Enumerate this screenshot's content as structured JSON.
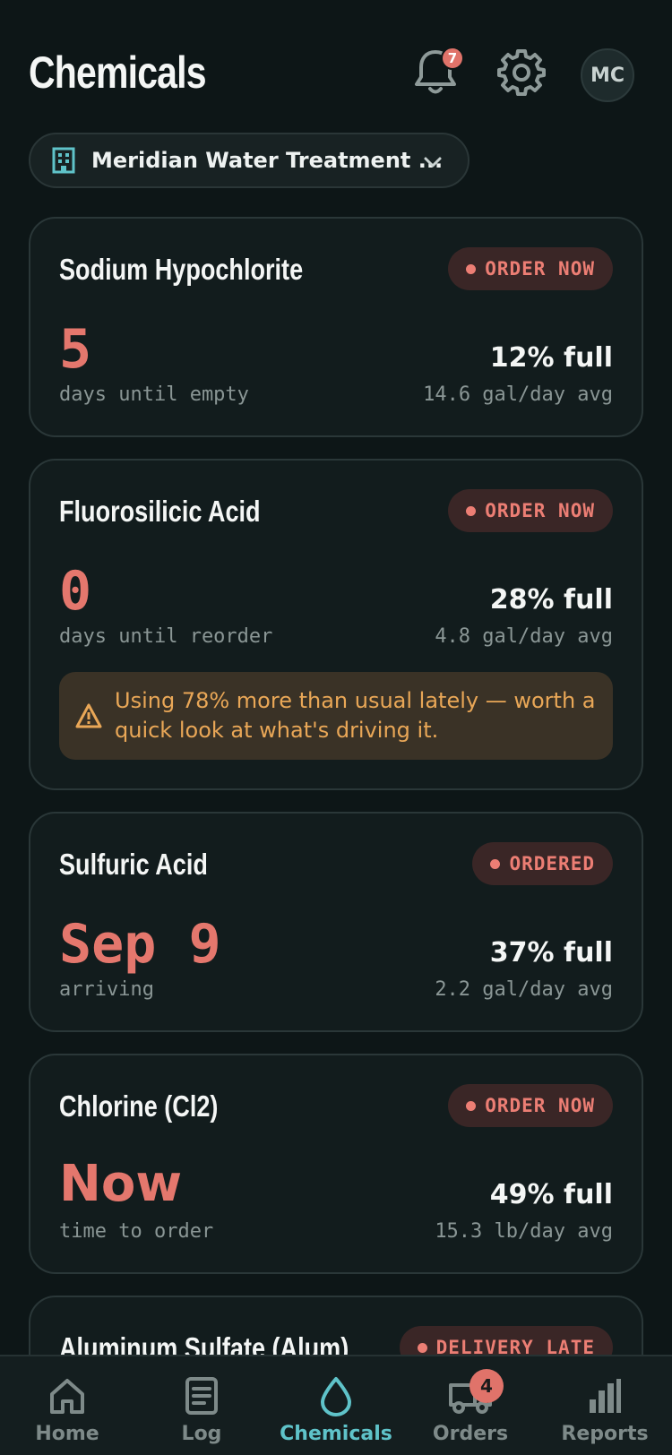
{
  "header": {
    "title": "Chemicals",
    "notifications_count": "7",
    "avatar_initials": "MC"
  },
  "site": {
    "name": "Meridian Water Treatment ..."
  },
  "chemicals": [
    {
      "name": "Sodium Hypochlorite",
      "status": "ORDER NOW",
      "big_value": "5",
      "big_label": "days until empty",
      "percent": "12% full",
      "rate": "14.6 gal/day avg"
    },
    {
      "name": "Fluorosilicic Acid",
      "status": "ORDER NOW",
      "big_value": "0",
      "big_label": "days until reorder",
      "percent": "28% full",
      "rate": "4.8 gal/day avg",
      "warning": "Using 78% more than usual lately — worth a quick look at what's driving it."
    },
    {
      "name": "Sulfuric Acid",
      "status": "ORDERED",
      "big_value": "Sep 9",
      "big_label": "arriving",
      "percent": "37% full",
      "rate": "2.2 gal/day avg"
    },
    {
      "name": "Chlorine (Cl2)",
      "status": "ORDER NOW",
      "big_value": "Now",
      "big_label": "time to order",
      "percent": "49% full",
      "rate": "15.3 lb/day avg"
    },
    {
      "name": "Aluminum Sulfate (Alum)",
      "status": "DELIVERY LATE"
    }
  ],
  "tabs": [
    {
      "label": "Home",
      "icon": "home-icon"
    },
    {
      "label": "Log",
      "icon": "log-icon"
    },
    {
      "label": "Chemicals",
      "icon": "drop-icon",
      "active": true
    },
    {
      "label": "Orders",
      "icon": "truck-icon",
      "badge": "4"
    },
    {
      "label": "Reports",
      "icon": "bar-chart-icon"
    }
  ],
  "colors": {
    "background": "#0d1617",
    "accent": "#5fc3c9",
    "alert": "#e4776d",
    "warning": "#e9a757"
  }
}
